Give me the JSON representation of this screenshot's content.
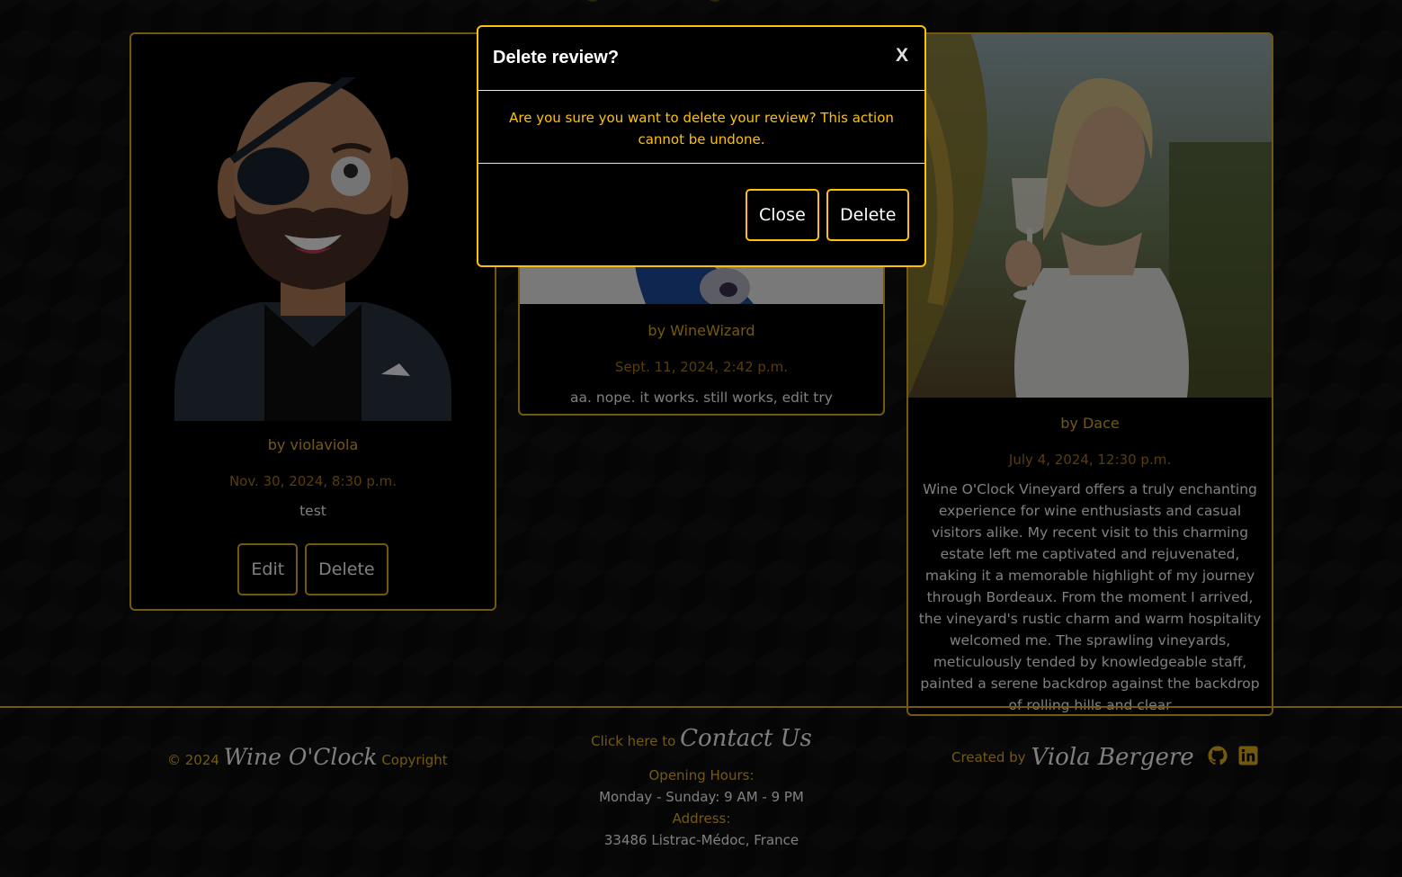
{
  "reviews": [
    {
      "author": "by violaviola",
      "date": "Nov. 30, 2024, 8:30 p.m.",
      "text": "test",
      "actions": {
        "edit_label": "Edit",
        "delete_label": "Delete"
      }
    },
    {
      "author": "by WineWizard",
      "date": "Sept. 11, 2024, 2:42 p.m.",
      "text": "aa. nope. it works. still works, edit try"
    },
    {
      "author": "by Dace",
      "date": "July 4, 2024, 12:30 p.m.",
      "text": "Wine O'Clock Vineyard offers a truly enchanting experience for wine enthusiasts and casual visitors alike. My recent visit to this charming estate left me captivated and rejuvenated, making it a memorable highlight of my journey through Bordeaux. From the moment I arrived, the vineyard's rustic charm and warm hospitality welcomed me. The sprawling vineyards, meticulously tended by knowledgeable staff, painted a serene backdrop against the backdrop of rolling hills and clear"
    }
  ],
  "footer": {
    "copyright_prefix": "© 2024",
    "brand": "Wine O'Clock",
    "copyright_suffix": "Copyright",
    "contact_prefix": "Click here to",
    "contact_link": "Contact Us",
    "hours_label": "Opening Hours:",
    "hours_value": "Monday - Sunday: 9 AM - 9 PM",
    "address_label": "Address:",
    "address_value": "33486 Listrac-Médoc, France",
    "created_prefix": "Created by",
    "creator": "Viola Bergere",
    "social_icons": [
      "github-icon",
      "linkedin-icon"
    ]
  },
  "modal": {
    "title": "Delete review?",
    "close_x": "X",
    "body": "Are you sure you want to delete your review? This action cannot be undone.",
    "close_label": "Close",
    "delete_label": "Delete"
  },
  "colors": {
    "accent_gold": "#e6b321",
    "modal_border": "#ffc107",
    "background": "#0b0b0b"
  }
}
